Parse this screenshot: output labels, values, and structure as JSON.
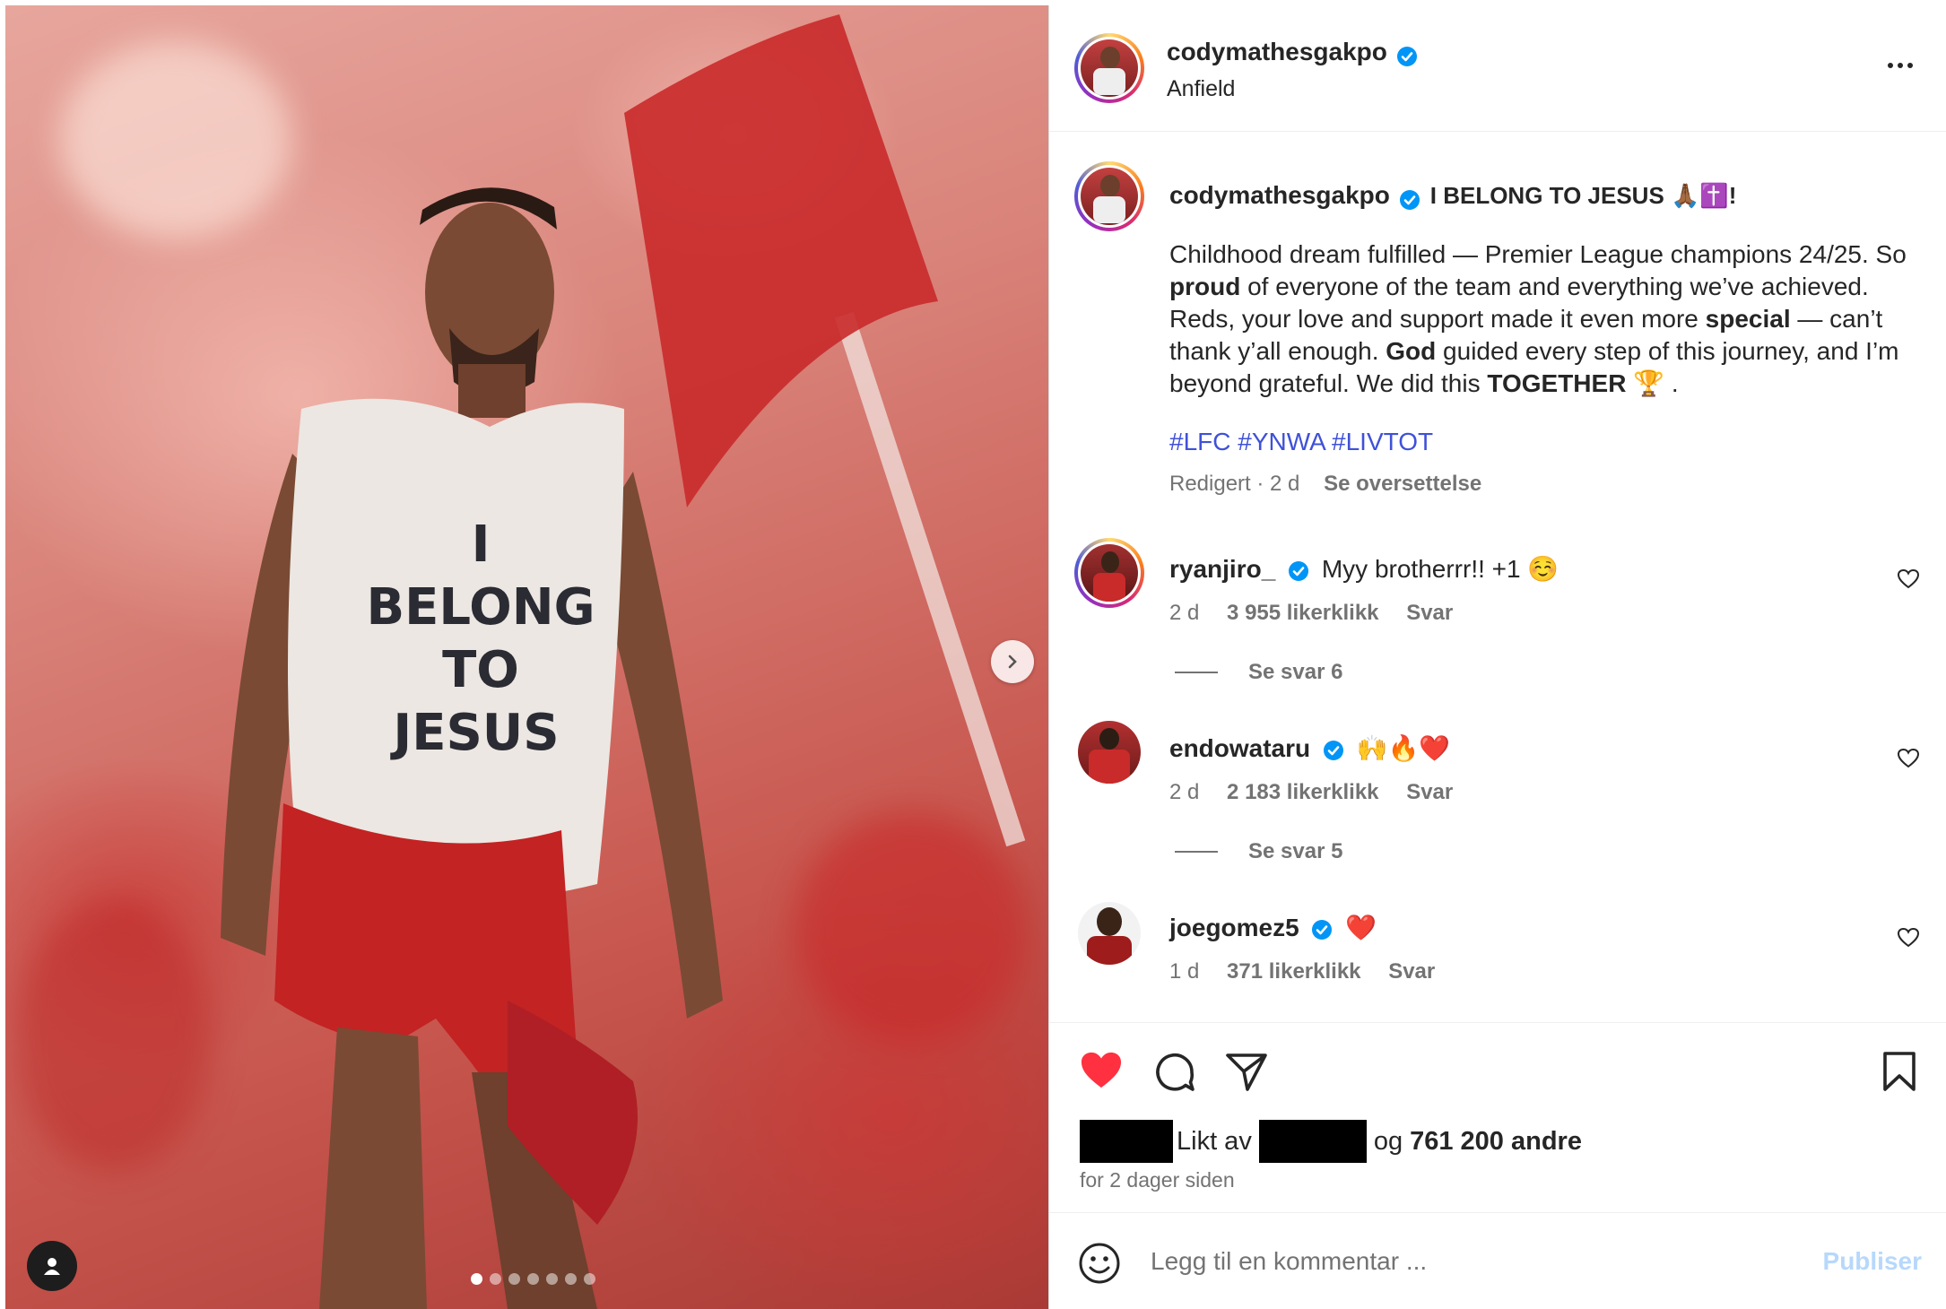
{
  "post": {
    "username": "codymathesgakpo",
    "location": "Anfield",
    "image_text": [
      "I",
      "BELONG",
      "TO",
      "JESUS"
    ],
    "carousel": {
      "count": 7,
      "active_index": 0
    }
  },
  "caption": {
    "username": "codymathesgakpo",
    "headline": "I BELONG TO JESUS 🙏🏾✝️!",
    "segments": [
      {
        "text": "Childhood dream fulfilled — Premier League champions 24/25. So ",
        "bold": false
      },
      {
        "text": "proud",
        "bold": true
      },
      {
        "text": " of everyone of the team and everything we’ve achieved. Reds, your love and support made it even more ",
        "bold": false
      },
      {
        "text": "special",
        "bold": true
      },
      {
        "text": " — can’t thank y’all enough. ",
        "bold": false
      },
      {
        "text": "God",
        "bold": true
      },
      {
        "text": " guided every step of this journey, and I’m beyond grateful. We did this ",
        "bold": false
      },
      {
        "text": "TOGETHER",
        "bold": true
      },
      {
        "text": " 🏆 .",
        "bold": false
      }
    ],
    "hashtags": "#LFC #YNWA #LIVTOT",
    "edited": "Redigert · 2 d",
    "translate": "Se oversettelse"
  },
  "comments": [
    {
      "username": "ryanjiro_",
      "text": "Myy brotherrr!! +1 ☺️",
      "age": "2 d",
      "likes": "3 955 likerklikk",
      "reply": "Svar",
      "view_replies": "Se svar 6"
    },
    {
      "username": "endowataru",
      "text": "🙌🔥❤️",
      "age": "2 d",
      "likes": "2 183 likerklikk",
      "reply": "Svar",
      "view_replies": "Se svar 5"
    },
    {
      "username": "joegomez5",
      "text": "❤️",
      "age": "1 d",
      "likes": "371 likerklikk",
      "reply": "Svar"
    }
  ],
  "likes": {
    "liked_by_label": "Likt av",
    "and_label": "og",
    "others": "761 200 andre",
    "time_ago": "for 2 dager siden",
    "liked": true
  },
  "composer": {
    "placeholder": "Legg til en kommentar ...",
    "post_label": "Publiser"
  },
  "colors": {
    "hashtag": "#3f51d8",
    "verified": "#0095f6",
    "liked_heart": "#ff3040",
    "post_disabled": "#b7d8fb"
  }
}
